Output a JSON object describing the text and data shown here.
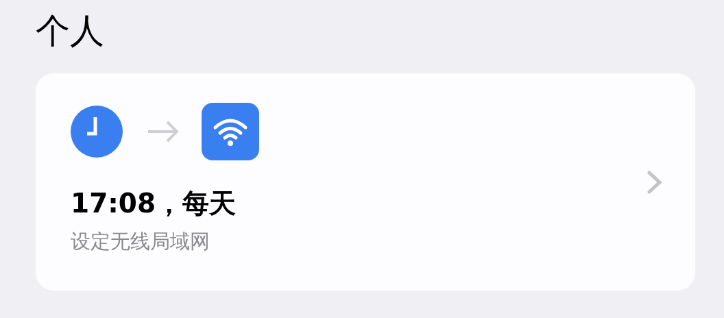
{
  "section": {
    "title": "个人"
  },
  "automation": {
    "summary": "17:08，每天",
    "action": "设定无线局域网"
  }
}
